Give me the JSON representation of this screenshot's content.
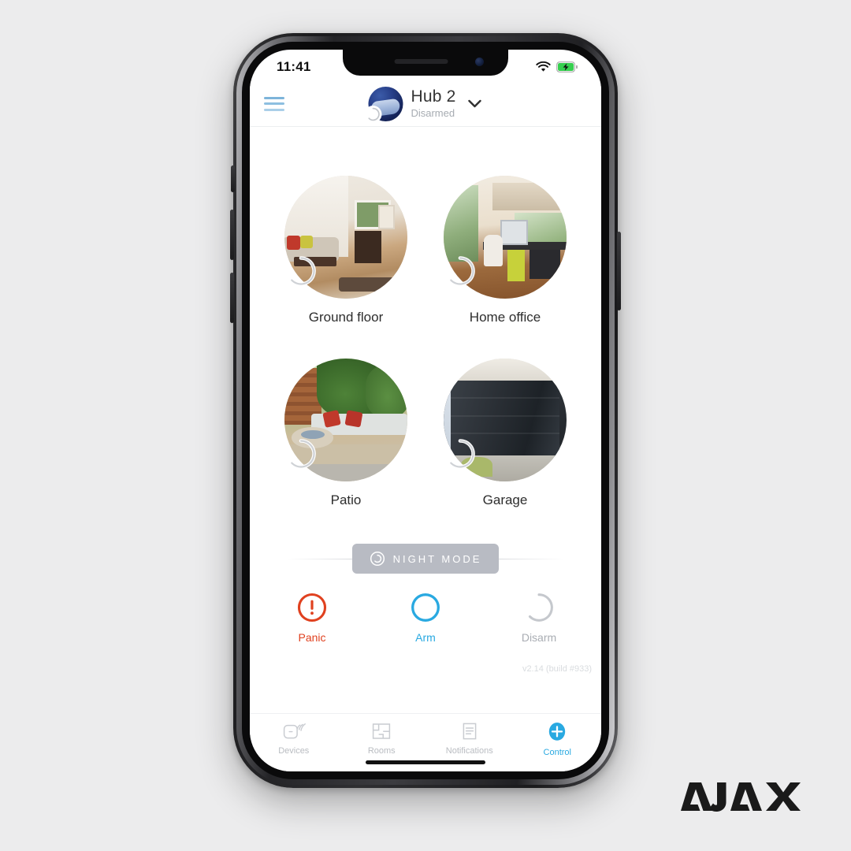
{
  "status_bar": {
    "time": "11:41",
    "wifi_icon": "wifi-icon",
    "battery_icon": "battery-charging-icon"
  },
  "header": {
    "menu_icon": "hamburger-menu-icon",
    "hub_avatar": "hub-avatar",
    "hub_badge_icon": "disarmed-arc-icon",
    "title": "Hub 2",
    "status": "Disarmed",
    "chevron_icon": "chevron-down-icon"
  },
  "rooms": [
    {
      "label": "Ground floor",
      "scene": "sc-ground",
      "badge_icon": "disarmed-arc-icon"
    },
    {
      "label": "Home office",
      "scene": "sc-office",
      "badge_icon": "disarmed-arc-icon"
    },
    {
      "label": "Patio",
      "scene": "sc-patio",
      "badge_icon": "disarmed-arc-icon"
    },
    {
      "label": "Garage",
      "scene": "sc-garage",
      "badge_icon": "disarmed-arc-icon"
    }
  ],
  "night_mode": {
    "label": "NIGHT MODE",
    "icon": "night-mode-arc-icon"
  },
  "modes": [
    {
      "label": "Panic",
      "icon": "panic-exclamation-icon",
      "color": "#e0411f"
    },
    {
      "label": "Arm",
      "icon": "arm-ring-icon",
      "color": "#29a9e1"
    },
    {
      "label": "Disarm",
      "icon": "disarm-arc-icon",
      "color": "#c2c5ca"
    }
  ],
  "version": "v2.14 (build #933)",
  "tabs": [
    {
      "label": "Devices",
      "icon": "device-signal-icon",
      "active": false
    },
    {
      "label": "Rooms",
      "icon": "floorplan-icon",
      "active": false
    },
    {
      "label": "Notifications",
      "icon": "list-document-icon",
      "active": false
    },
    {
      "label": "Control",
      "icon": "plus-circle-icon",
      "active": true
    }
  ],
  "brand": {
    "logo": "AJAX"
  },
  "colors": {
    "accent_blue": "#29a9e1",
    "panic_red": "#e0411f",
    "night_gray": "#b8bbc3",
    "muted": "#b9bcc1"
  }
}
